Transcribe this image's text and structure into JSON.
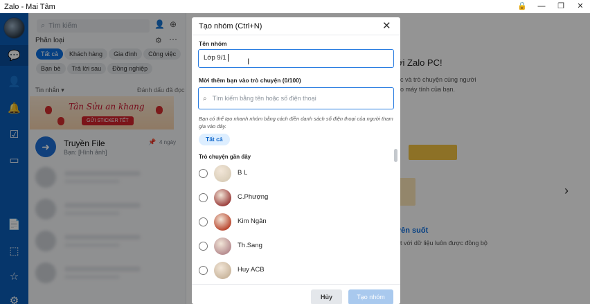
{
  "window": {
    "title": "Zalo - Mai Tâm",
    "controls": [
      "🔒",
      "—",
      "❐",
      "✕"
    ]
  },
  "rail": {
    "icons": [
      "chat-icon",
      "contacts-icon",
      "bell-icon",
      "todo-icon",
      "video-icon",
      "file-icon",
      "screenshot-icon",
      "star-icon",
      "settings-icon"
    ]
  },
  "list": {
    "search_placeholder": "Tìm kiếm",
    "category_label": "Phân loại",
    "chips": [
      "Tất cả",
      "Khách hàng",
      "Gia đình",
      "Công việc",
      "Bạn bè",
      "Trả lời sau",
      "Đồng nghiệp"
    ],
    "inbox_label": "Tin nhắn",
    "mark_read": "Đánh dấu đã đọc",
    "banner_text": "Tân Sửu an khang",
    "banner_button": "GỬI STICKER TẾT",
    "pinned_chat": {
      "name": "Truyền File",
      "preview": "Bạn: [Hình ảnh]",
      "time": "4 ngày"
    }
  },
  "welcome": {
    "title": "ới Zalo PC!",
    "subtitle": "ệc và trò chuyện cùng người\nho máy tính của bạn.",
    "feature_title": "yên suốt",
    "feature_subtitle": "ệt với dữ liệu luôn được đồng bộ"
  },
  "modal": {
    "title": "Tạo nhóm (Ctrl+N)",
    "group_name_label": "Tên nhóm",
    "group_name_value": "Lớp 9/1",
    "add_friends_label": "Mời thêm bạn vào trò chuyện (0/100)",
    "search_placeholder": "Tìm kiếm bằng tên hoặc số điện thoại",
    "hint": "Bạn có thể tạo nhanh nhóm bằng cách điền danh sách số điện thoại của người tham gia vào đây.",
    "filter_all": "Tất cả",
    "recent_label": "Trò chuyện gần đây",
    "contacts": [
      {
        "name": "B L",
        "color": "#d9cdb8"
      },
      {
        "name": "C.Phượng",
        "color": "#9a3c3a"
      },
      {
        "name": "Kim Ngân",
        "color": "#b8432a"
      },
      {
        "name": "Th.Sang",
        "color": "#b58a8e"
      },
      {
        "name": "Huy ACB",
        "color": "#c9b59c"
      }
    ],
    "cancel_button": "Hủy",
    "create_button": "Tạo nhóm"
  }
}
